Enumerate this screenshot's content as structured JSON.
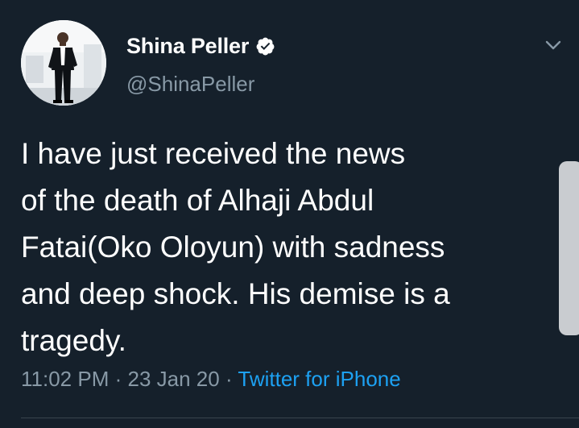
{
  "author": {
    "display_name": "Shina Peller",
    "handle": "@ShinaPeller",
    "verified": true
  },
  "tweet": {
    "lines": [
      "I have just received the news",
      "of the death of Alhaji Abdul",
      "Fatai(Oko Oloyun) with sadness",
      "and deep shock. His demise is a",
      "tragedy."
    ],
    "time": "11:02 PM",
    "date": "23 Jan 20",
    "separator": "·",
    "source": "Twitter for iPhone"
  },
  "colors": {
    "background": "#15202b",
    "text": "#ffffff",
    "secondary": "#8899a6",
    "link": "#1da1f2"
  },
  "icons": {
    "verified": "verified-badge-icon",
    "menu": "chevron-down-icon"
  }
}
